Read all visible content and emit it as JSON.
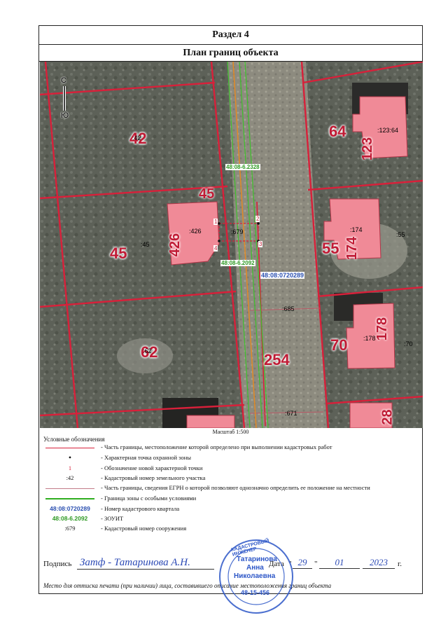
{
  "header": {
    "section": "Раздел 4",
    "title": "План границ объекта"
  },
  "compass": {
    "north": "С",
    "south": "Ю"
  },
  "map_labels": {
    "parcels": [
      {
        "big": "42",
        "small": ":42"
      },
      {
        "big": "45",
        "small": ":45"
      },
      {
        "big": "45",
        "small": ""
      },
      {
        "big": "426",
        "small": ":426"
      },
      {
        "big": "62",
        "small": ":62"
      },
      {
        "big": "254",
        "small": ""
      },
      {
        "big": "64",
        "small": ":123:64"
      },
      {
        "big": "123",
        "small": ""
      },
      {
        "big": "55",
        "small": ":55"
      },
      {
        "big": "174",
        "small": ":174"
      },
      {
        "big": "70",
        "small": ":70"
      },
      {
        "big": "178",
        "small": ":178"
      },
      {
        "big": "28",
        "small": ""
      }
    ],
    "object": ":679",
    "zouit_top": "48:08-6.2328",
    "zouit_bottom": "48:08-6.2092",
    "quarter": "48:08:0720289",
    "small_685": ":685",
    "small_671": ":671",
    "points": [
      "1",
      "2",
      "3",
      "4"
    ]
  },
  "scale": "Масштаб 1:500",
  "legend": {
    "title": "Условные обозначения",
    "items": [
      {
        "symbol": "",
        "text": "- Часть границы, местоположение которой определено при выполнении кадастровых работ"
      },
      {
        "symbol": "•",
        "text": "- Характерная точка охранной зоны"
      },
      {
        "symbol": "1",
        "text": "- Обозначение новой характерной точки"
      },
      {
        "symbol": ":42",
        "text": "- Кадастровый номер земельного участка"
      },
      {
        "symbol": "",
        "text": "- Часть границы, сведения ЕГРН о которой позволяют однозначно определить ее положение на местности"
      },
      {
        "symbol": "",
        "text": "- Граница зоны с особыми условиями"
      },
      {
        "symbol": "48:08:0720289",
        "text": "- Номер кадастрового квартала"
      },
      {
        "symbol": "48:08-6.2092",
        "text": "- ЗОУИТ"
      },
      {
        "symbol": ":679",
        "text": "- Кадастровый номер сооружения"
      }
    ]
  },
  "signature": {
    "label": "Подпись",
    "handwritten": "Затф - Татаринова А.Н.",
    "date_label": "Дата",
    "day": "29",
    "month": "01",
    "year": "2023",
    "year_suffix": "г."
  },
  "footer_note": "Место для оттиска печати (при наличии) лица, составившего описание местоположения границ объекта",
  "stamp": {
    "ring": "КАДАСТРОВЫЙ ИНЖЕНЕР",
    "name1": "Татаринова",
    "name2": "Анна",
    "name3": "Николаевна",
    "cert": "48-15-456"
  },
  "colors": {
    "red_line": "#d8203a",
    "green_line": "#2fae1f",
    "quarter_blue": "#2a4fb0",
    "zouit_green": "#2f9a24",
    "building_pink": "#f08a97",
    "stamp_blue": "#2c56c7"
  }
}
